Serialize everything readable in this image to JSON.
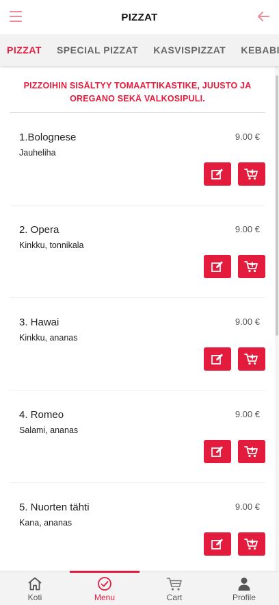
{
  "header": {
    "title": "PIZZAT"
  },
  "tabs": [
    {
      "label": "PIZZAT"
    },
    {
      "label": "SPECIAL PIZZAT"
    },
    {
      "label": "KASVISPIZZAT"
    },
    {
      "label": "KEBABIT"
    }
  ],
  "notice": "PIZZOIHIN SISÄLTYY TOMAATTIKASTIKE, JUUSTO JA OREGANO SEKÄ VALKOSIPULI.",
  "items": [
    {
      "name": "1.Bolognese",
      "price": "9.00 €",
      "desc": "Jauheliha"
    },
    {
      "name": "2. Opera",
      "price": "9.00 €",
      "desc": "Kinkku, tonnikala"
    },
    {
      "name": "3. Hawai",
      "price": "9.00 €",
      "desc": "Kinkku, ananas"
    },
    {
      "name": "4. Romeo",
      "price": "9.00 €",
      "desc": "Salami, ananas"
    },
    {
      "name": "5. Nuorten tähti",
      "price": "9.00 €",
      "desc": "Kana, ananas"
    }
  ],
  "bottom_nav": [
    {
      "label": "Koti",
      "icon": "home-icon"
    },
    {
      "label": "Menu",
      "icon": "check-circle-icon"
    },
    {
      "label": "Cart",
      "icon": "cart-icon"
    },
    {
      "label": "Profile",
      "icon": "person-icon"
    }
  ],
  "colors": {
    "accent": "#e31b3c",
    "menu_icon": "#f0879a",
    "tab_bar": "#f2f2f2",
    "bottom_bar": "#f3f3f3"
  }
}
